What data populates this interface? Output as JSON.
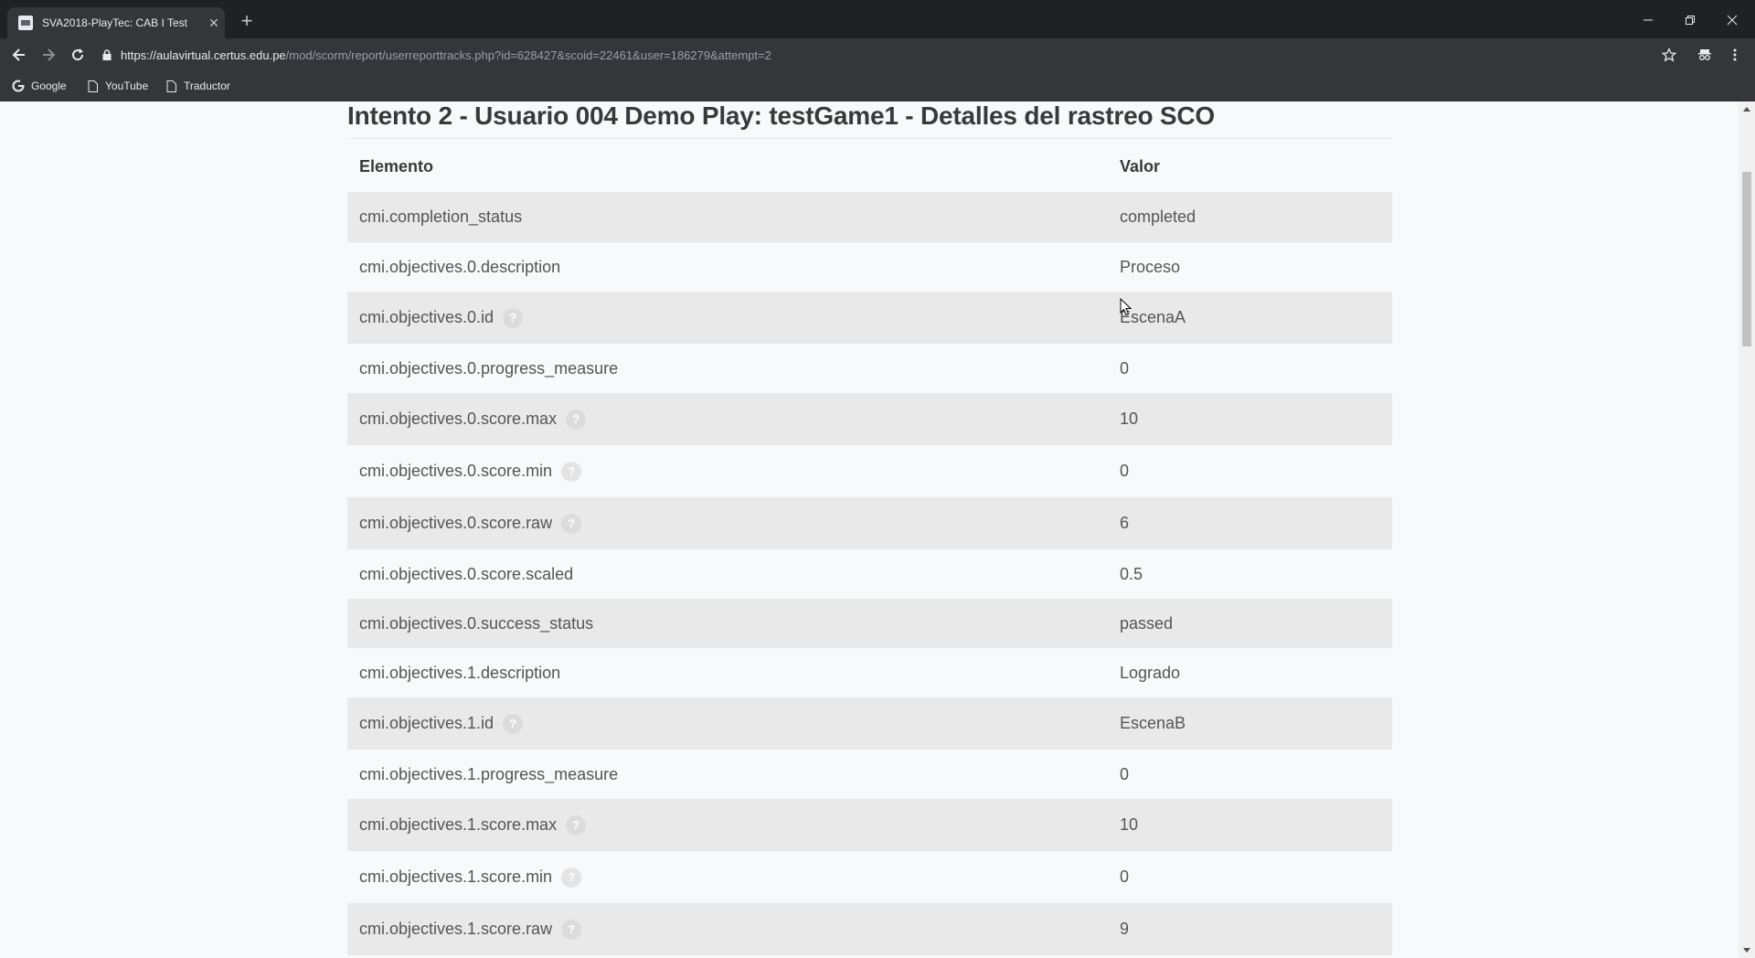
{
  "browser": {
    "tab_title": "SVA2018-PlayTec: CAB I Test",
    "url_host": "https://aulavirtual.certus.edu.pe",
    "url_path": "/mod/scorm/report/userreporttracks.php?id=628427&scoid=22461&user=186279&attempt=2",
    "bookmarks": [
      "Google",
      "YouTube",
      "Traductor"
    ]
  },
  "page": {
    "title": "Intento 2 - Usuario 004 Demo Play: testGame1 - Detalles del rastreo SCO",
    "columns": [
      "Elemento",
      "Valor"
    ],
    "rows": [
      {
        "element": "cmi.completion_status",
        "value": "completed",
        "help": false
      },
      {
        "element": "cmi.objectives.0.description",
        "value": "Proceso",
        "help": false
      },
      {
        "element": "cmi.objectives.0.id",
        "value": "EscenaA",
        "help": true
      },
      {
        "element": "cmi.objectives.0.progress_measure",
        "value": "0",
        "help": false
      },
      {
        "element": "cmi.objectives.0.score.max",
        "value": "10",
        "help": true
      },
      {
        "element": "cmi.objectives.0.score.min",
        "value": "0",
        "help": true
      },
      {
        "element": "cmi.objectives.0.score.raw",
        "value": "6",
        "help": true
      },
      {
        "element": "cmi.objectives.0.score.scaled",
        "value": "0.5",
        "help": false
      },
      {
        "element": "cmi.objectives.0.success_status",
        "value": "passed",
        "help": false
      },
      {
        "element": "cmi.objectives.1.description",
        "value": "Logrado",
        "help": false
      },
      {
        "element": "cmi.objectives.1.id",
        "value": "EscenaB",
        "help": true
      },
      {
        "element": "cmi.objectives.1.progress_measure",
        "value": "0",
        "help": false
      },
      {
        "element": "cmi.objectives.1.score.max",
        "value": "10",
        "help": true
      },
      {
        "element": "cmi.objectives.1.score.min",
        "value": "0",
        "help": true
      },
      {
        "element": "cmi.objectives.1.score.raw",
        "value": "9",
        "help": true
      }
    ],
    "help_glyph": "?"
  }
}
